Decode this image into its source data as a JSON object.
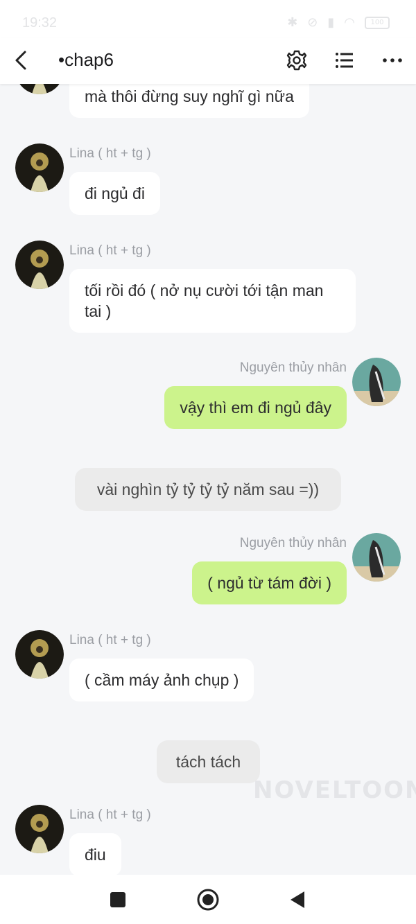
{
  "status": {
    "time": "19:32",
    "battery": "100"
  },
  "header": {
    "title": "•chap6"
  },
  "messages": {
    "m0": {
      "text": "mà thôi đừng suy nghĩ gì nữa"
    },
    "m1": {
      "sender": "Lina ( ht + tg )",
      "text": "đi ngủ đi"
    },
    "m2": {
      "sender": "Lina ( ht + tg )",
      "text": "tối rồi đó ( nở nụ cười tới tận man tai )"
    },
    "m3": {
      "sender": "Nguyên thủy nhân",
      "text": "vậy thì em đi ngủ đây"
    },
    "m4": {
      "text": "vài nghìn tỷ tỷ tỷ tỷ năm sau =))"
    },
    "m5": {
      "sender": "Nguyên thủy nhân",
      "text": "( ngủ từ tám đời )"
    },
    "m6": {
      "sender": "Lina ( ht + tg )",
      "text": "( cầm máy ảnh chụp )"
    },
    "m7": {
      "text": "tách tách"
    },
    "m8": {
      "sender": "Lina ( ht + tg )",
      "text": "điu"
    }
  },
  "watermark": "NOVELTOON",
  "colors": {
    "outgoing_bubble": "#ccf38c",
    "incoming_bubble": "#ffffff",
    "narration_bubble": "#ebebeb",
    "background": "#f5f6f8"
  },
  "icons": [
    "back-arrow-icon",
    "gear-icon",
    "list-icon",
    "more-dots-icon",
    "square-icon",
    "circle-icon",
    "triangle-back-icon"
  ]
}
